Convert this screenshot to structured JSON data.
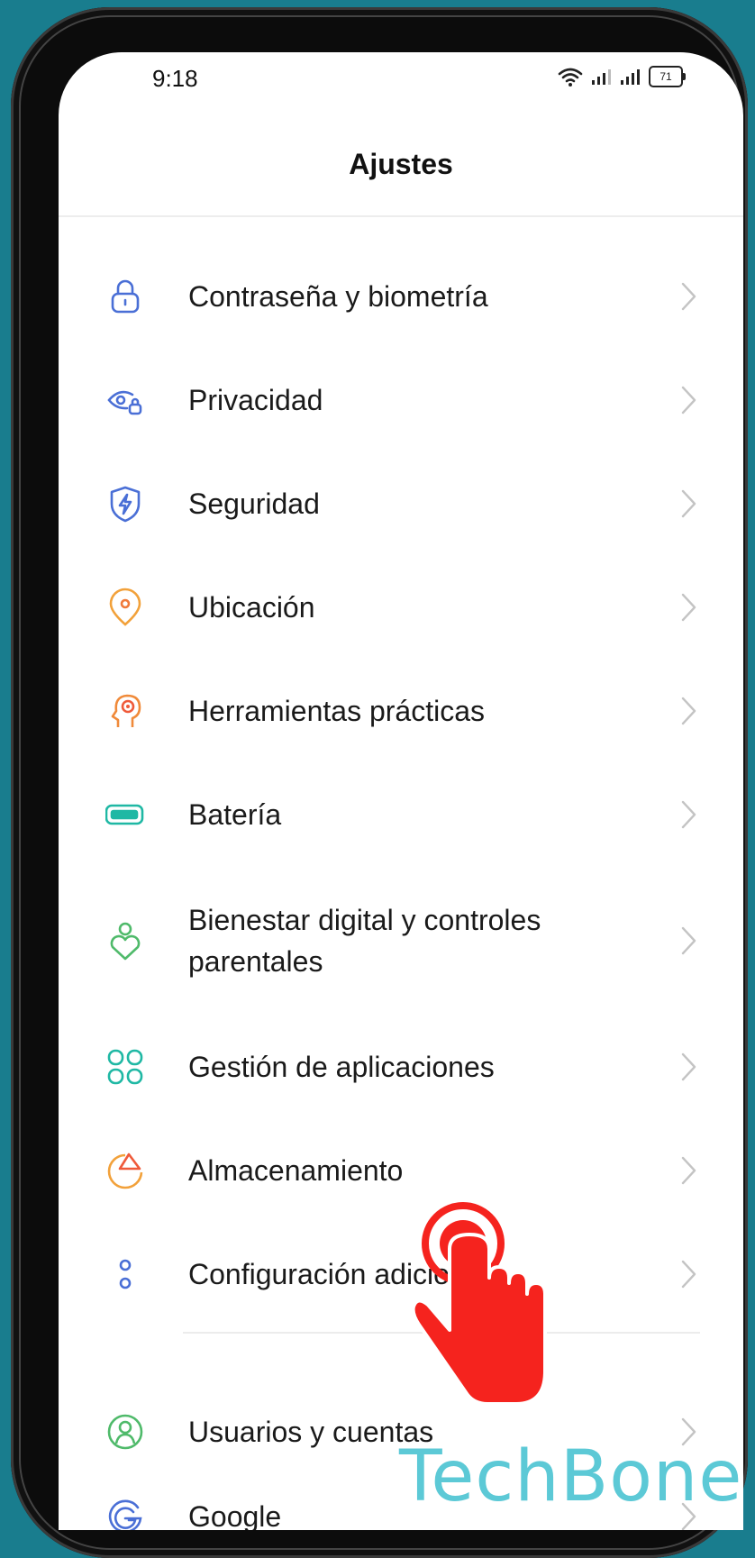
{
  "status_bar": {
    "time": "9:18",
    "battery_level": "71"
  },
  "header": {
    "title": "Ajustes"
  },
  "settings": [
    {
      "label": "Contraseña y biometría",
      "icon": "lock-icon",
      "color": "#4a6fd6"
    },
    {
      "label": "Privacidad",
      "icon": "privacy-eye-icon",
      "color": "#4a6fd6"
    },
    {
      "label": "Seguridad",
      "icon": "shield-bolt-icon",
      "color": "#4a6fd6"
    },
    {
      "label": "Ubicación",
      "icon": "location-pin-icon",
      "color": "#f2a13a"
    },
    {
      "label": "Herramientas prácticas",
      "icon": "tools-head-icon",
      "color": "#f08a3a"
    },
    {
      "label": "Batería",
      "icon": "battery-icon",
      "color": "#1fb8a4"
    },
    {
      "label": "Bienestar digital y controles parentales",
      "icon": "wellbeing-heart-icon",
      "color": "#4fba6a"
    },
    {
      "label": "Gestión de aplicaciones",
      "icon": "apps-grid-icon",
      "color": "#1fb8a4"
    },
    {
      "label": "Almacenamiento",
      "icon": "storage-pie-icon",
      "color": "#f2a13a"
    },
    {
      "label": "Configuración adicional",
      "icon": "more-dots-icon",
      "color": "#4a6fd6"
    },
    {
      "label": "Usuarios y cuentas",
      "icon": "users-icon",
      "color": "#4fba6a"
    },
    {
      "label": "Google",
      "icon": "google-icon",
      "color": "#4a6fd6"
    }
  ],
  "watermark": {
    "text": "TechBone"
  },
  "colors": {
    "background": "#197d8e",
    "accent_red": "#f5231e",
    "chevron": "#c4c4c4"
  }
}
